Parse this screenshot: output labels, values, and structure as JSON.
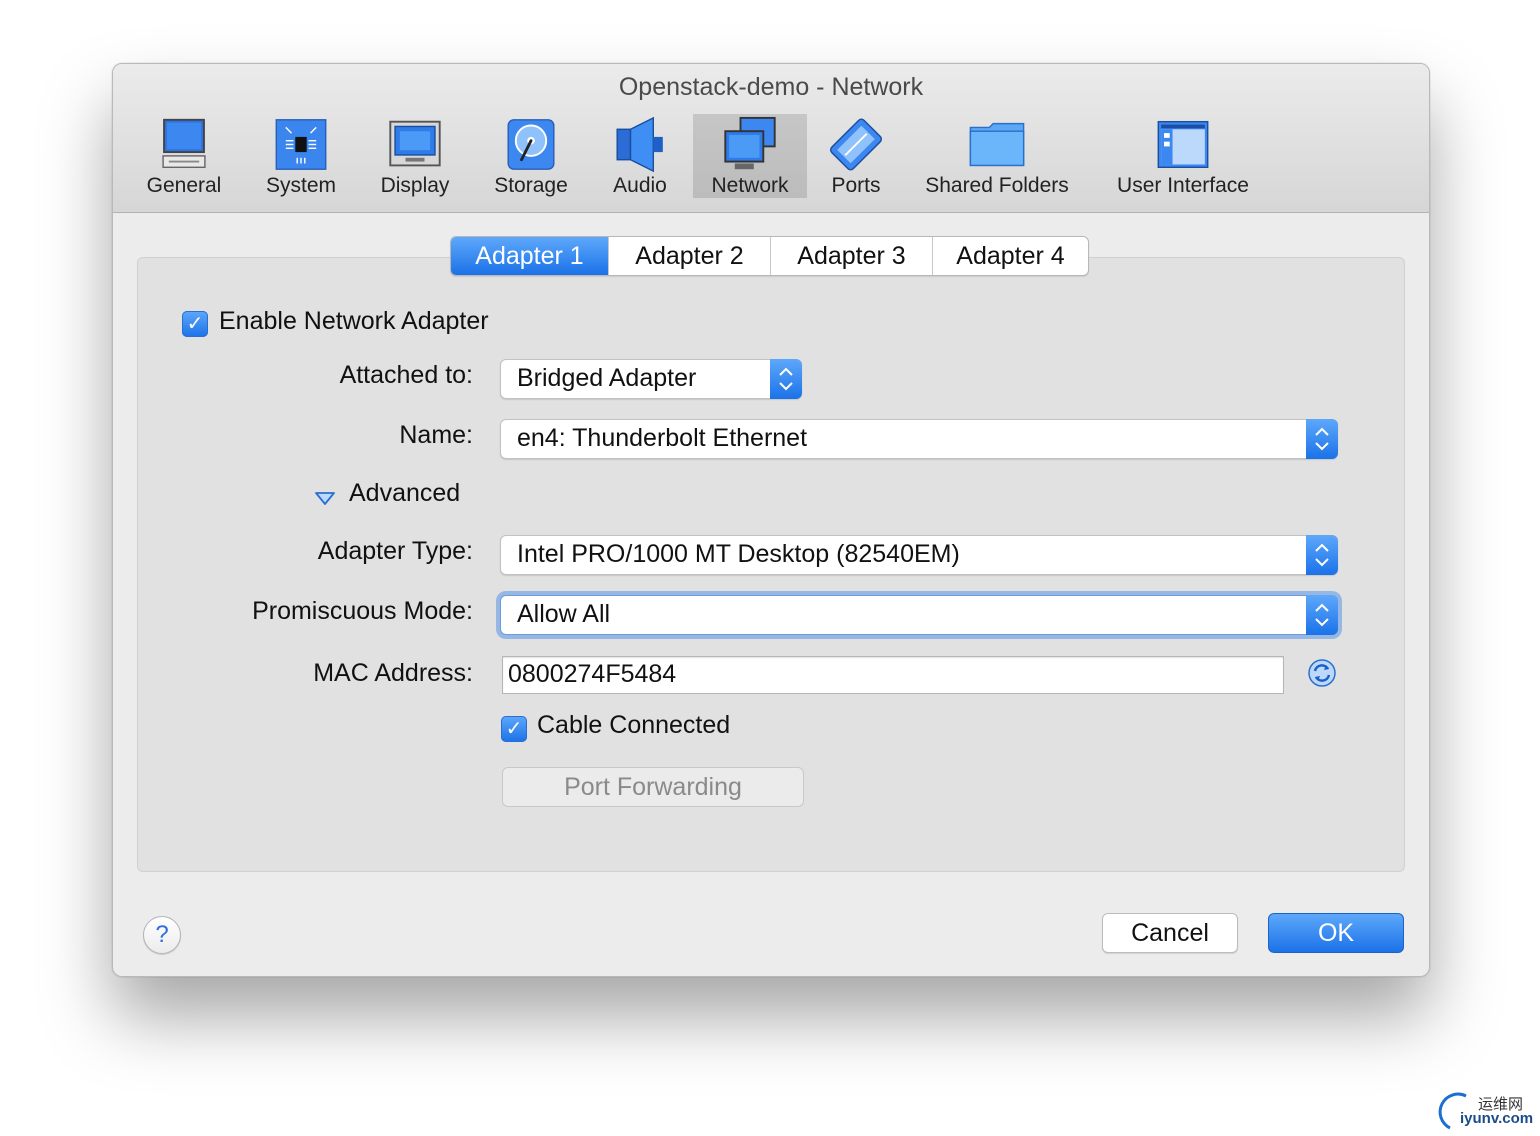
{
  "window": {
    "title": "Openstack-demo - Network"
  },
  "toolbar": {
    "items": [
      {
        "label": "General",
        "icon": "monitor-computer-icon"
      },
      {
        "label": "System",
        "icon": "chip-board-icon"
      },
      {
        "label": "Display",
        "icon": "display-monitor-icon"
      },
      {
        "label": "Storage",
        "icon": "hard-disk-icon"
      },
      {
        "label": "Audio",
        "icon": "speaker-icon"
      },
      {
        "label": "Network",
        "icon": "network-monitors-icon",
        "selected": true
      },
      {
        "label": "Ports",
        "icon": "serial-port-icon"
      },
      {
        "label": "Shared Folders",
        "icon": "folder-icon"
      },
      {
        "label": "User Interface",
        "icon": "window-layout-icon"
      }
    ]
  },
  "tabs": [
    {
      "label": "Adapter 1",
      "active": true
    },
    {
      "label": "Adapter 2"
    },
    {
      "label": "Adapter 3"
    },
    {
      "label": "Adapter 4"
    }
  ],
  "form": {
    "enable_adapter": {
      "label": "Enable Network Adapter",
      "checked": true
    },
    "attached_to": {
      "label": "Attached to:",
      "value": "Bridged Adapter"
    },
    "name": {
      "label": "Name:",
      "value": "en4: Thunderbolt Ethernet"
    },
    "advanced": {
      "label": "Advanced",
      "expanded": true
    },
    "adapter_type": {
      "label": "Adapter Type:",
      "value": "Intel PRO/1000 MT Desktop (82540EM)"
    },
    "promiscuous_mode": {
      "label": "Promiscuous Mode:",
      "value": "Allow All"
    },
    "mac_address": {
      "label": "MAC Address:",
      "value": "0800274F5484"
    },
    "cable_connected": {
      "label": "Cable Connected",
      "checked": true
    },
    "port_forwarding": {
      "label": "Port Forwarding"
    }
  },
  "footer": {
    "help": "?",
    "cancel": "Cancel",
    "ok": "OK"
  },
  "watermark": {
    "cn": "运维网",
    "en": "iyunv.com"
  },
  "colors": {
    "accent": "#1b72e8",
    "accent_light": "#5ea8fb",
    "background": "#ececec"
  }
}
